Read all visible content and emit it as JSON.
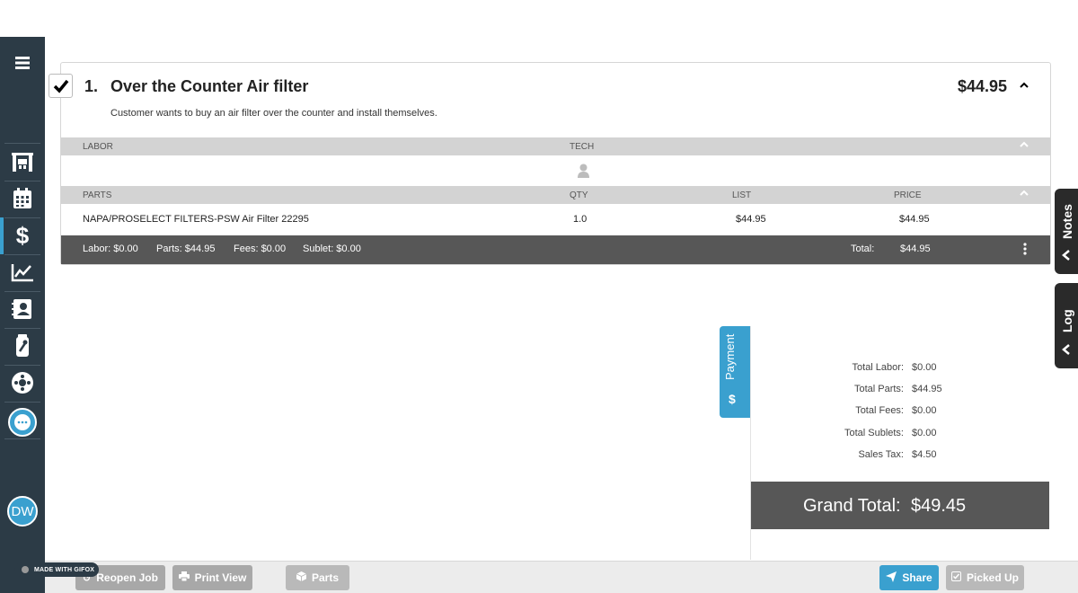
{
  "job": {
    "number": "1.",
    "title": "Over the Counter Air filter",
    "price": "$44.95",
    "description": "Customer wants to buy an air filter over the counter and install themselves."
  },
  "labor": {
    "header": "LABOR",
    "tech_header": "TECH"
  },
  "parts": {
    "header": "PARTS",
    "qty_header": "QTY",
    "list_header": "LIST",
    "price_header": "PRICE",
    "rows": [
      {
        "name": "NAPA/PROSELECT FILTERS-PSW Air Filter 22295",
        "qty": "1.0",
        "list": "$44.95",
        "price": "$44.95"
      }
    ]
  },
  "job_totals": {
    "labor": "Labor: $0.00",
    "parts": "Parts: $44.95",
    "fees": "Fees: $0.00",
    "sublet": "Sublet: $0.00",
    "total_label": "Total:",
    "total_value": "$44.95"
  },
  "payment": {
    "tab_label": "Payment",
    "tab_icon": "$",
    "rows": [
      {
        "label": "Total Labor:",
        "value": "$0.00"
      },
      {
        "label": "Total Parts:",
        "value": "$44.95"
      },
      {
        "label": "Total Fees:",
        "value": "$0.00"
      },
      {
        "label": "Total Sublets:",
        "value": "$0.00"
      },
      {
        "label": "Sales Tax:",
        "value": "$4.50"
      }
    ],
    "grand_total_label": "Grand Total:",
    "grand_total_value": "$49.45"
  },
  "side_tabs": {
    "notes": "Notes",
    "log": "Log"
  },
  "user": {
    "initials": "DW"
  },
  "watermark": "MADE WITH GIFOX",
  "footer": {
    "reopen": "Reopen Job",
    "print": "Print View",
    "parts": "Parts",
    "share": "Share",
    "picked_up": "Picked Up"
  },
  "colors": {
    "sidebar": "#2c3b46",
    "accent": "#3aa0cf",
    "dark_bar": "#575757",
    "section_header": "#d3d3d3"
  }
}
